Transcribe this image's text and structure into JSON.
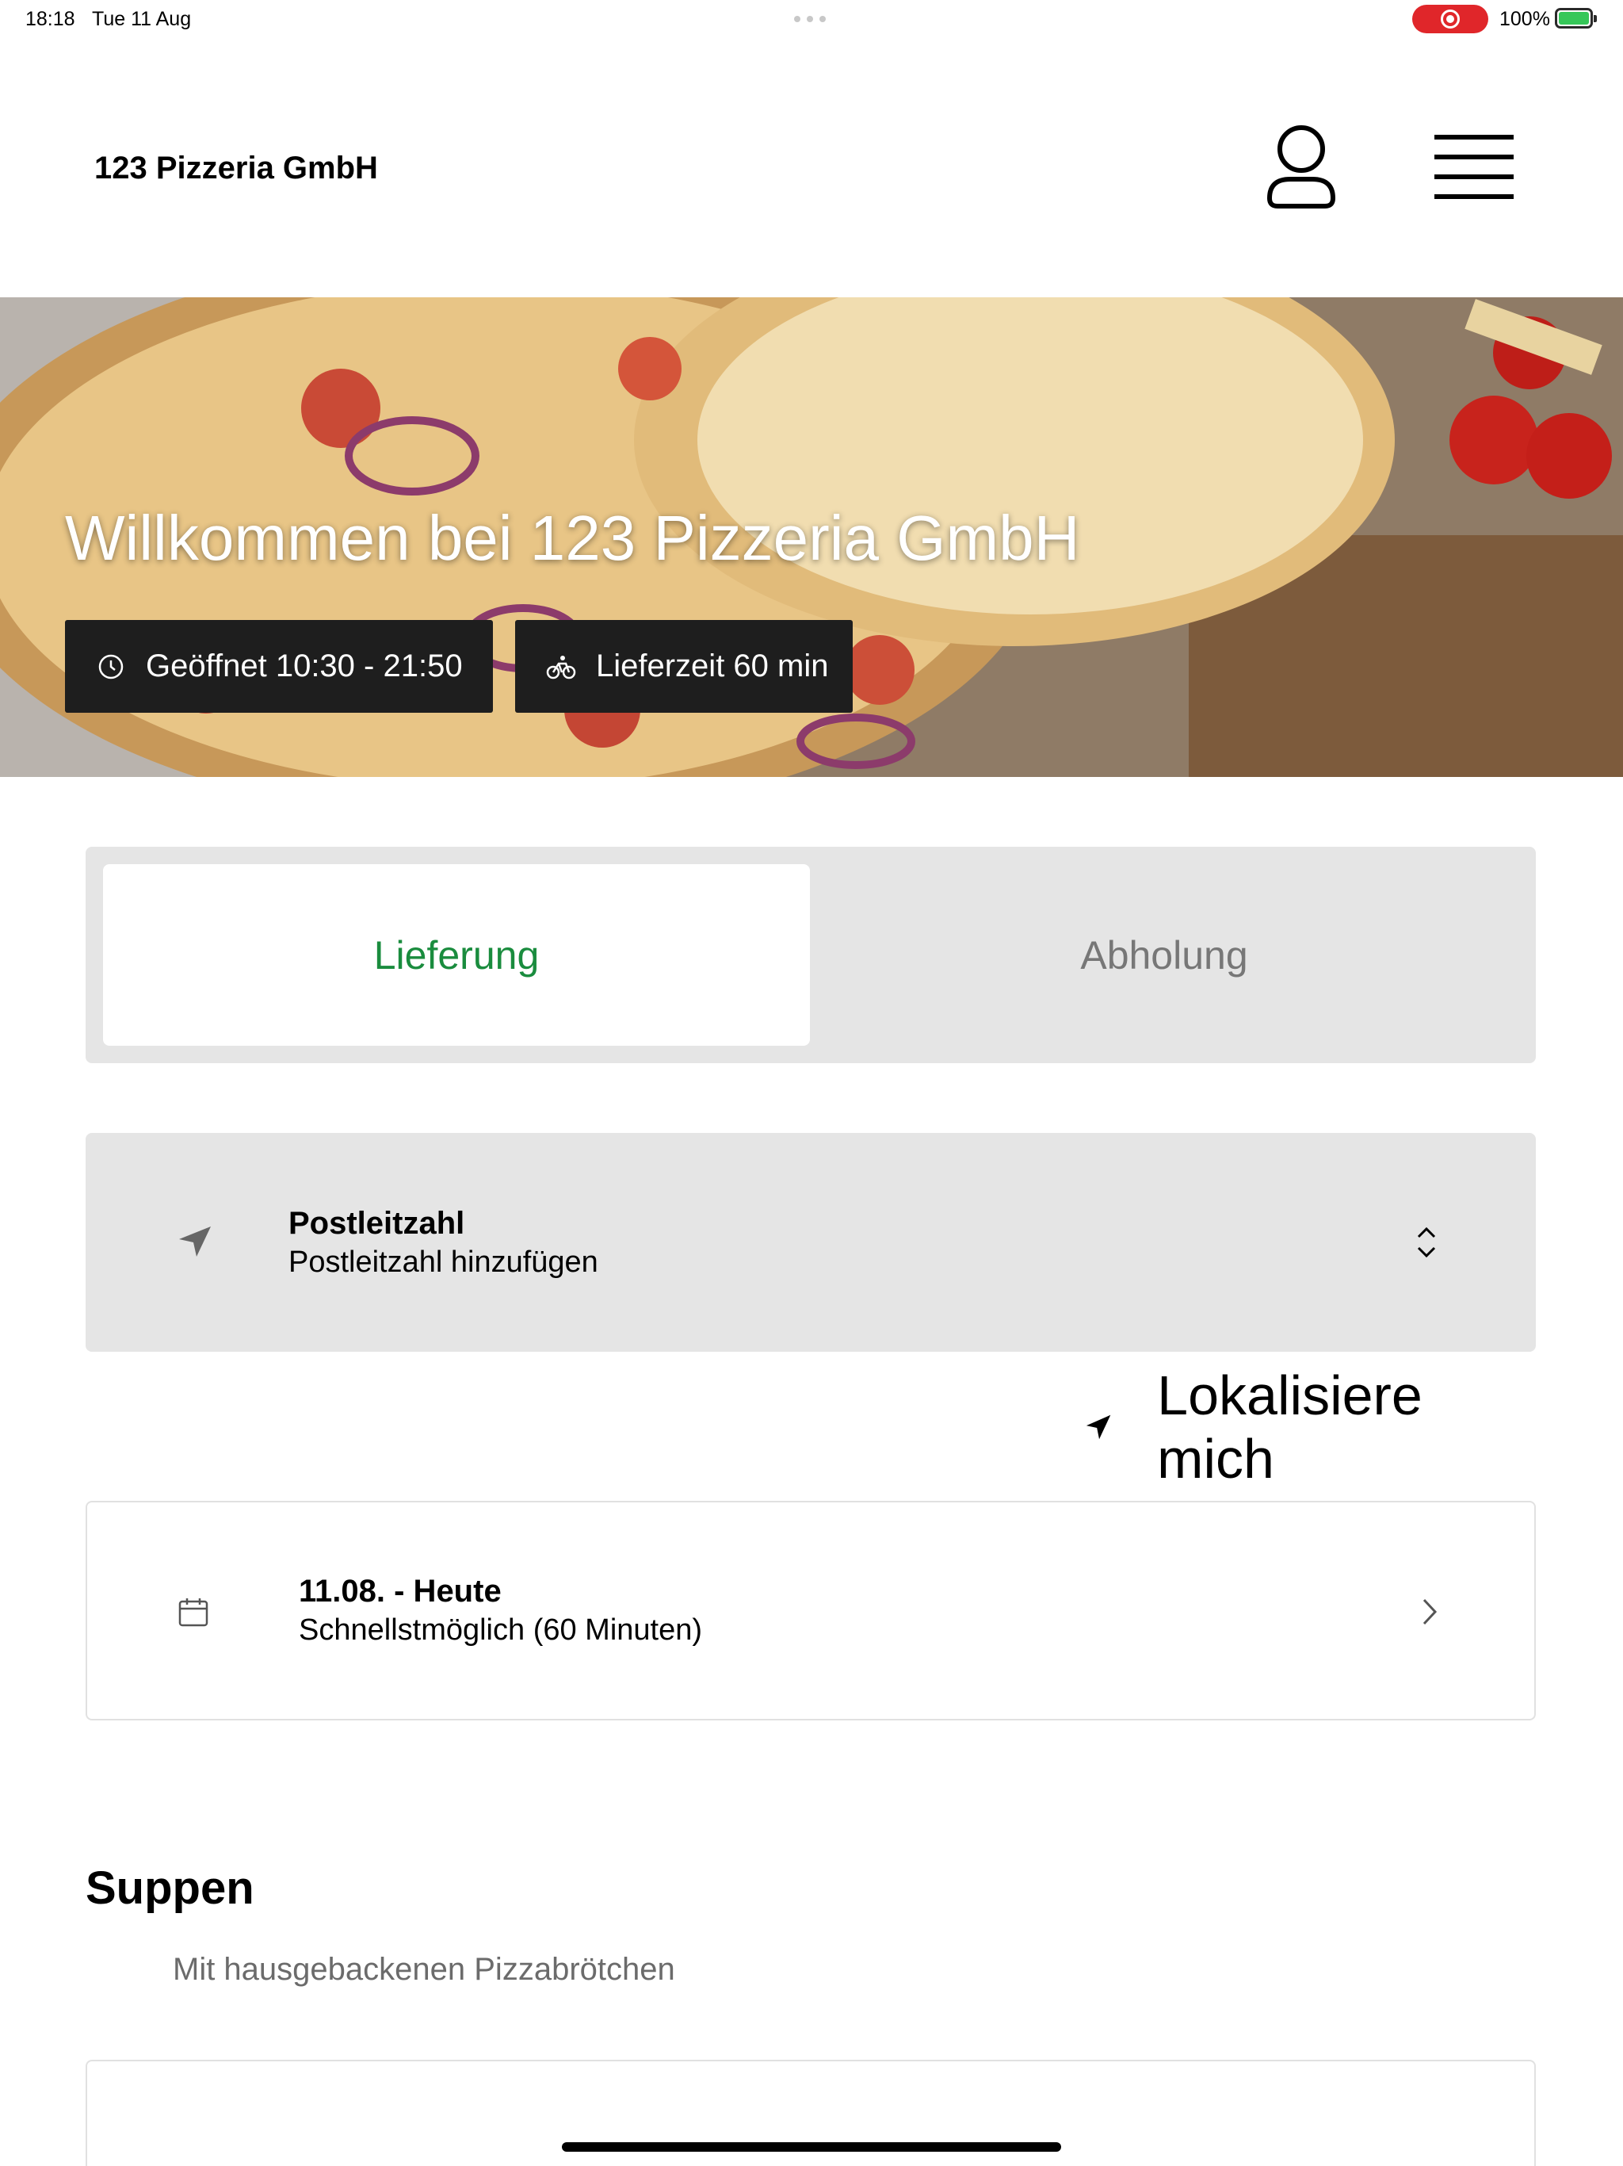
{
  "status_bar": {
    "time": "18:18",
    "date": "Tue 11 Aug",
    "battery": "100%",
    "recording_color": "#e0262a",
    "battery_color": "#36c759"
  },
  "header": {
    "brand": "123 Pizzeria GmbH",
    "user_icon": "user-icon",
    "menu_icon": "hamburger-menu-icon"
  },
  "hero": {
    "title": "Willkommen bei 123 Pizzeria GmbH",
    "opening_hours": "Geöffnet 10:30 - 21:50",
    "delivery_time": "Lieferzeit 60 min",
    "opening_icon": "clock-icon",
    "delivery_icon": "bicycle-icon"
  },
  "order_mode": {
    "tabs": [
      {
        "label": "Lieferung",
        "selected": true
      },
      {
        "label": "Abholung",
        "selected": false
      }
    ],
    "accent_color": "#1a8c3e"
  },
  "postcode": {
    "label": "Postleitzahl",
    "value": "Postleitzahl hinzufügen",
    "icon": "location-arrow-icon"
  },
  "locate_me": {
    "label": "Lokalisiere mich",
    "icon": "location-arrow-icon"
  },
  "delivery_date": {
    "date": "11.08. - Heute",
    "time": "Schnellstmöglich (60 Minuten)",
    "icon": "calendar-icon"
  },
  "category": {
    "title": "Suppen",
    "subtitle": "Mit hausgebackenen Pizzabrötchen"
  }
}
